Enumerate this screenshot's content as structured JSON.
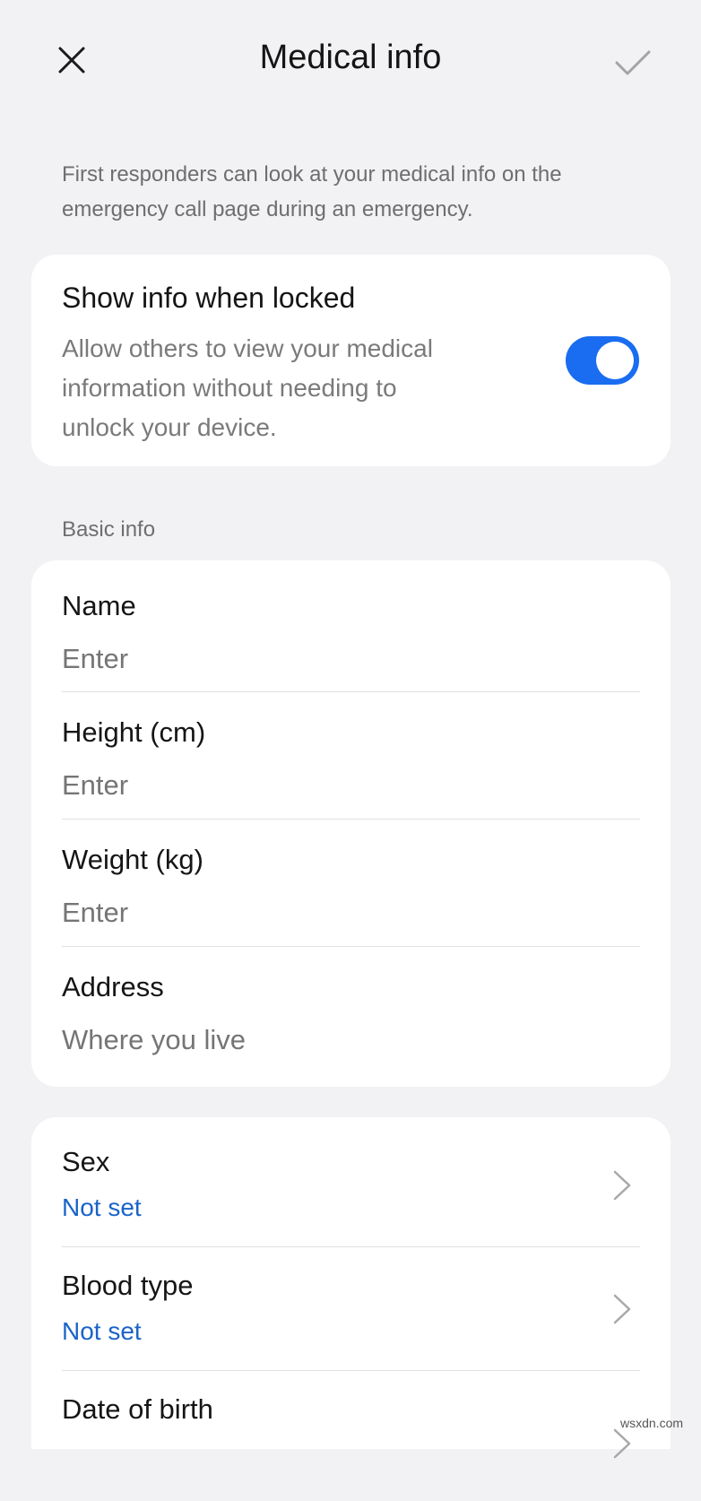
{
  "header": {
    "title": "Medical info",
    "close_icon": "close-icon",
    "confirm_icon": "check-icon"
  },
  "description": "First responders can look at your medical info on the emergency call page during an emergency.",
  "lock_setting": {
    "title": "Show info when locked",
    "subtitle_lines": [
      "Allow others to view your medical",
      "information without needing to",
      "unlock your device."
    ],
    "enabled": true,
    "accent_color": "#1a6cf0"
  },
  "basic_info": {
    "section_label": "Basic info",
    "fields": [
      {
        "label": "Name",
        "placeholder": "Enter",
        "value": ""
      },
      {
        "label": "Height (cm)",
        "placeholder": "Enter",
        "value": ""
      },
      {
        "label": "Weight (kg)",
        "placeholder": "Enter",
        "value": ""
      },
      {
        "label": "Address",
        "placeholder": "Where you live",
        "value": ""
      }
    ]
  },
  "selectors": [
    {
      "label": "Sex",
      "value": "Not set"
    },
    {
      "label": "Blood type",
      "value": "Not set"
    },
    {
      "label": "Date of birth",
      "value": ""
    }
  ],
  "watermark": "wsxdn.com"
}
